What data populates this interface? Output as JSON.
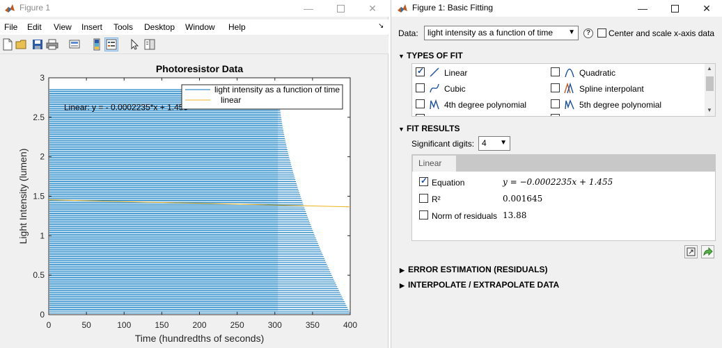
{
  "figure_window": {
    "title": "Figure 1",
    "menu": [
      "File",
      "Edit",
      "View",
      "Insert",
      "Tools",
      "Desktop",
      "Window",
      "Help"
    ],
    "dock_glyph": "↘",
    "toolbar_icons": [
      "new-figure-icon",
      "open-file-icon",
      "save-icon",
      "print-icon",
      "print-preview-icon",
      "colorbar-icon",
      "legend-icon",
      "pointer-icon",
      "property-inspector-icon"
    ]
  },
  "chart_data": {
    "type": "line",
    "title": "Photoresistor Data",
    "xlabel": "Time (hundredths of seconds)",
    "ylabel": "Light Intensity (lumen)",
    "xlim": [
      0,
      400
    ],
    "ylim": [
      0,
      3
    ],
    "xticks": [
      "0",
      "50",
      "100",
      "150",
      "200",
      "250",
      "300",
      "350",
      "400"
    ],
    "yticks": [
      "0",
      "0.5",
      "1",
      "1.5",
      "2",
      "2.5",
      "3"
    ],
    "legend": {
      "placement": "top-right",
      "entries": [
        "light intensity as a function of time",
        "linear"
      ]
    },
    "annotation": "Linear:  y = - 0.0002235*x + 1.455",
    "series": [
      {
        "name": "light intensity as a function of time",
        "color": "#0072bd",
        "description_values": {
          "plateau_level": 2.85,
          "plateau_end_x": 305,
          "decay_end_x": 400,
          "decay_end_y": 0.02
        }
      },
      {
        "name": "linear",
        "color": "#edb120",
        "x": [
          0,
          400
        ],
        "y": [
          1.455,
          1.3656
        ]
      }
    ]
  },
  "fitting_window": {
    "title": "Figure 1: Basic Fitting",
    "data_label": "Data:",
    "data_selected": "light intensity as a function of time",
    "center_scale_label": "Center and scale x-axis data",
    "types_header": "TYPES OF FIT",
    "fit_types": [
      {
        "label": "Linear",
        "checked": true,
        "icon": "linear-fit-icon"
      },
      {
        "label": "Quadratic",
        "checked": false,
        "icon": "quadratic-fit-icon"
      },
      {
        "label": "Cubic",
        "checked": false,
        "icon": "cubic-fit-icon"
      },
      {
        "label": "Spline interpolant",
        "checked": false,
        "icon": "spline-fit-icon"
      },
      {
        "label": "4th degree polynomial",
        "checked": false,
        "icon": "poly4-fit-icon"
      },
      {
        "label": "5th degree polynomial",
        "checked": false,
        "icon": "poly5-fit-icon"
      }
    ],
    "results_header": "FIT RESULTS",
    "sig_digits_label": "Significant digits:",
    "sig_digits_value": "4",
    "results_tab": "Linear",
    "results": [
      {
        "label": "Equation",
        "checked": true,
        "value": "y = −0.0002235x + 1.455"
      },
      {
        "label": "R²",
        "checked": false,
        "value": "0.001645"
      },
      {
        "label": "Norm of residuals",
        "checked": false,
        "value": "13.88"
      }
    ],
    "error_header": "ERROR ESTIMATION (RESIDUALS)",
    "interp_header": "INTERPOLATE / EXTRAPOLATE DATA"
  }
}
